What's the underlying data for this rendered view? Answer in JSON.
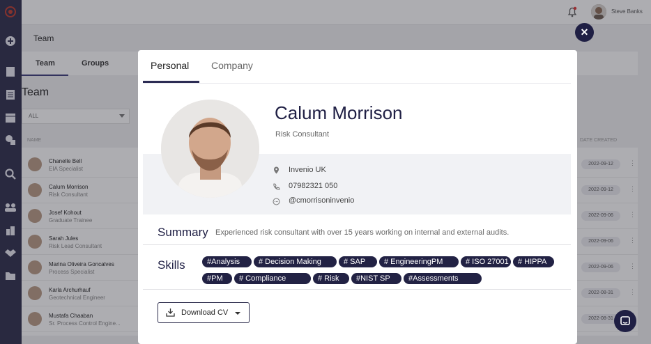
{
  "topbar": {
    "username": "Steve Banks"
  },
  "background_page": {
    "title": "Team",
    "tabs": [
      {
        "label": "Team"
      },
      {
        "label": "Groups"
      }
    ],
    "heading": "Team",
    "filter": {
      "value": "ALL"
    },
    "columns": {
      "name": "NAME",
      "date_created": "DATE CREATED"
    },
    "rows": [
      {
        "name": "Chanelle Bell",
        "role": "EIA Specialist",
        "date": "2022-09-12"
      },
      {
        "name": "Calum Morrison",
        "role": "Risk Consultant",
        "date": "2022-09-12"
      },
      {
        "name": "Josef Kohout",
        "role": "Graduate Trainee",
        "date": "2022-09-06"
      },
      {
        "name": "Sarah Jules",
        "role": "Risk Lead Consultant",
        "date": "2022-09-06"
      },
      {
        "name": "Marina Oliveira Goncalves",
        "role": "Process Specialist",
        "date": "2022-09-06"
      },
      {
        "name": "Karla Archurhauf",
        "role": "Geotechnical Engineer",
        "date": "2022-08-31"
      },
      {
        "name": "Mustafa Chaaban",
        "role": "Sr. Process Control Engine...",
        "date": "2022-08-31"
      }
    ]
  },
  "modal": {
    "tabs": [
      {
        "label": "Personal"
      },
      {
        "label": "Company"
      }
    ],
    "active_tab": "Personal",
    "person": {
      "name": "Calum Morrison",
      "role": "Risk Consultant",
      "location": "Invenio UK",
      "phone": "07982321 050",
      "handle": "@cmorrisoninvenio"
    },
    "summary": {
      "title": "Summary",
      "text": "Experienced risk consultant with over 15 years working on internal and external audits."
    },
    "skills": {
      "title": "Skills",
      "items": [
        "#Analysis",
        "# Decision Making",
        "# SAP",
        "# EngineeringPM",
        "# ISO 27001",
        "# HIPPA",
        "#PM",
        "# Compliance",
        "# Risk",
        "#NIST SP",
        "#Assessments"
      ]
    },
    "download": {
      "label": "Download CV"
    }
  },
  "colors": {
    "navy": "#1f1f44",
    "rail": "#2a2a4a",
    "chip": "#222244"
  }
}
